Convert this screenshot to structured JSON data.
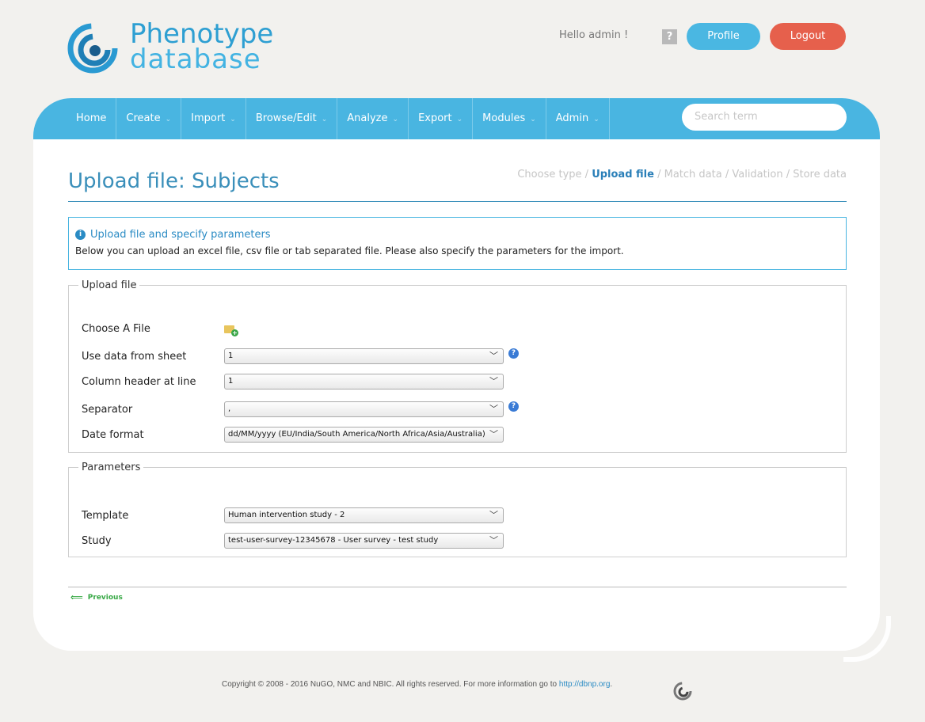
{
  "header": {
    "logo_line1": "Phenotype",
    "logo_line2": "database",
    "greeting": "Hello admin !",
    "help_label": "?",
    "profile_label": "Profile",
    "logout_label": "Logout"
  },
  "nav": {
    "items": [
      {
        "label": "Home",
        "caret": ""
      },
      {
        "label": "Create",
        "caret": "⌄"
      },
      {
        "label": "Import",
        "caret": "⌄"
      },
      {
        "label": "Browse/Edit",
        "caret": "⌄"
      },
      {
        "label": "Analyze",
        "caret": "⌄"
      },
      {
        "label": "Export",
        "caret": "⌄"
      },
      {
        "label": "Modules",
        "caret": "⌄"
      },
      {
        "label": "Admin",
        "caret": "⌄"
      }
    ],
    "search_placeholder": "Search term"
  },
  "page": {
    "title": "Upload file: Subjects",
    "steps": {
      "s1": "Choose type",
      "s2": "Upload file",
      "s3": "Match data",
      "s4": "Validation",
      "s5": "Store data",
      "sep": " / "
    }
  },
  "info": {
    "icon": "i",
    "title": "Upload file and specify parameters",
    "text": "Below you can upload an excel file, csv file or tab separated file. Please also specify the parameters for the import."
  },
  "upload": {
    "legend": "Upload file",
    "choose_file_label": "Choose A File",
    "sheet_label": "Use data from sheet",
    "sheet_value": "1",
    "header_label": "Column header at line",
    "header_value": "1",
    "separator_label": "Separator",
    "separator_value": ",",
    "date_label": "Date format",
    "date_value": "dd/MM/yyyy (EU/India/South America/North Africa/Asia/Australia)"
  },
  "params": {
    "legend": "Parameters",
    "template_label": "Template",
    "template_value": "Human intervention study - 2",
    "study_label": "Study",
    "study_value": "test-user-survey-12345678 - User survey - test study"
  },
  "nav_bottom": {
    "previous_label": "Previous"
  },
  "footer": {
    "text": "Copyright © 2008 - 2016 NuGO, NMC and NBIC. All rights reserved. For more information go to ",
    "link": "http://dbnp.org",
    "after": "."
  },
  "icons": {
    "select_arrow": "﹀",
    "help": "?"
  }
}
